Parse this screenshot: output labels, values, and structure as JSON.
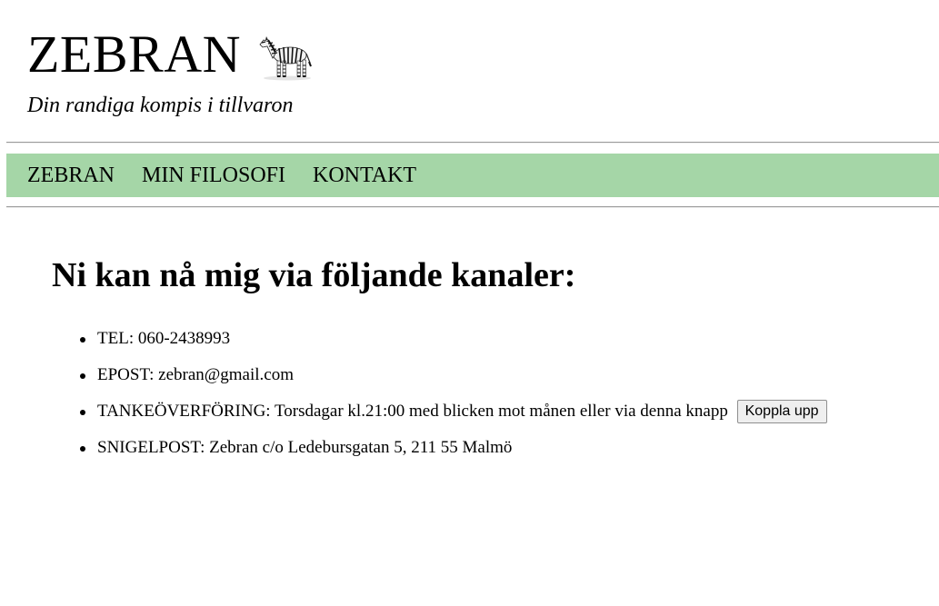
{
  "header": {
    "logo_text": "ZEBRAN",
    "tagline": "Din randiga kompis i tillvaron"
  },
  "nav": {
    "items": [
      {
        "label": "ZEBRAN"
      },
      {
        "label": "MIN FILOSOFI"
      },
      {
        "label": "KONTAKT"
      }
    ]
  },
  "colors": {
    "nav_background": "#a5d6a7"
  },
  "main": {
    "title": "Ni kan nå mig via följande kanaler:",
    "channels": [
      {
        "text": "TEL: 060-2438993"
      },
      {
        "text": "EPOST: zebran@gmail.com"
      },
      {
        "text": "TANKEÖVERFÖRING: Torsdagar kl.21:00 med blicken mot månen eller via denna knapp",
        "button_label": "Koppla upp"
      },
      {
        "text": "SNIGELPOST: Zebran c/o Ledebursgatan 5, 211 55 Malmö"
      }
    ]
  }
}
